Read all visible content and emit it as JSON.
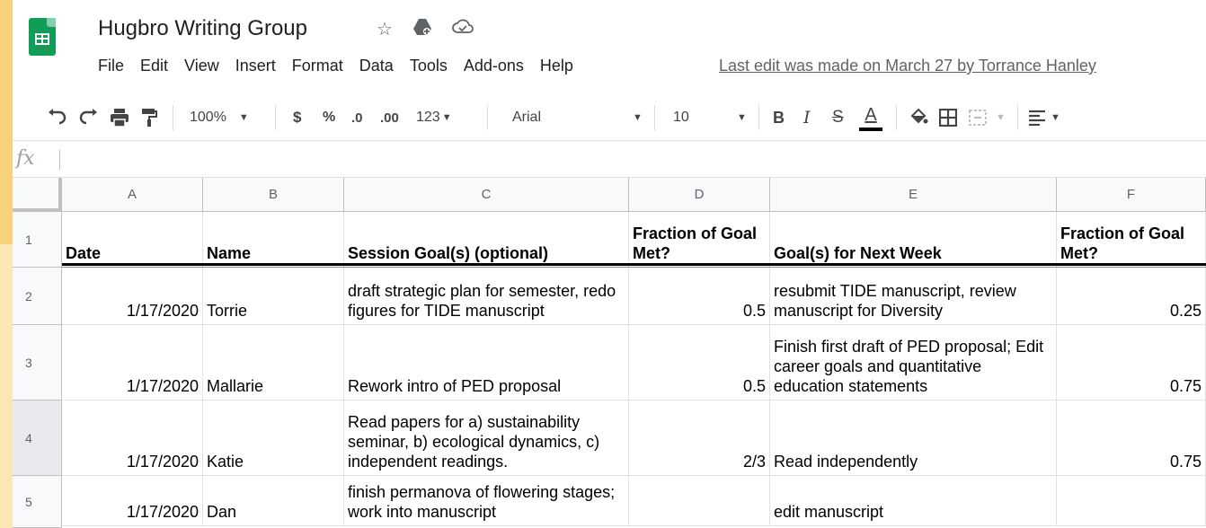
{
  "app": {
    "doc_title": "Hugbro Writing Group",
    "last_edit": "Last edit was made on March 27 by Torrance Hanley"
  },
  "menu": [
    "File",
    "Edit",
    "View",
    "Insert",
    "Format",
    "Data",
    "Tools",
    "Add-ons",
    "Help"
  ],
  "toolbar": {
    "zoom": "100%",
    "currency": "$",
    "percent": "%",
    "dec_less": ".0",
    "dec_more": ".00",
    "more_formats": "123",
    "font": "Arial",
    "font_size": "10",
    "bold": "B",
    "italic": "I",
    "strike": "S",
    "text_color": "A"
  },
  "formula_bar": {
    "fx": "fx",
    "value": ""
  },
  "columns": [
    "A",
    "B",
    "C",
    "D",
    "E",
    "F"
  ],
  "rows": [
    {
      "num": "1",
      "cells": [
        "Date",
        "Name",
        "Session Goal(s) (optional)",
        "Fraction of Goal Met?",
        "Goal(s) for Next Week",
        "Fraction of Goal Met?"
      ]
    },
    {
      "num": "2",
      "cells": [
        "1/17/2020",
        "Torrie",
        "draft strategic plan for semester, redo figures for TIDE manuscript",
        "0.5",
        "resubmit TIDE manuscript, review manuscript for Diversity",
        "0.25"
      ]
    },
    {
      "num": "3",
      "cells": [
        "1/17/2020",
        "Mallarie",
        "Rework intro of PED proposal",
        "0.5",
        "Finish first draft of PED proposal; Edit career goals and quantitative education statements",
        "0.75"
      ]
    },
    {
      "num": "4",
      "cells": [
        "1/17/2020",
        "Katie",
        "Read papers for a) sustainability seminar, b) ecological dynamics, c) independent readings.",
        "2/3",
        "Read independently",
        "0.75"
      ]
    },
    {
      "num": "5",
      "cells": [
        "1/17/2020",
        "Dan",
        "finish permanova of flowering stages; work into manuscript",
        "",
        "edit manuscript",
        ""
      ]
    }
  ]
}
